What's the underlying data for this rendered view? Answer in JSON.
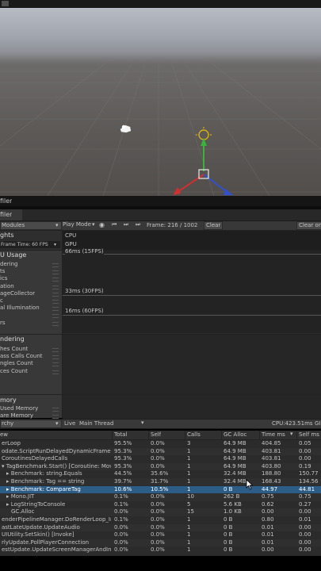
{
  "toolbar_top": {
    "bg": "#1a1a1a"
  },
  "scene": {
    "gizmo_colors": {
      "x": "#d03030",
      "y": "#3ab33a",
      "z": "#3050d0",
      "light": "#f2c200"
    }
  },
  "profiler_tab_bar": {
    "label": "filer"
  },
  "profiler_window_tab": {
    "label": "filer"
  },
  "toolbar": {
    "modules_label": "Modules",
    "play_mode_label": "Play Mode",
    "frame_label": "Frame: 216 / 1002",
    "clear_label": "Clear",
    "clear_on_label": "Clear on"
  },
  "modules": {
    "highlights_title": "ghts",
    "frame_time_label": "Frame Time: 60 FPS",
    "cpu_header": "U Usage",
    "cpu_items": [
      "dering",
      "ts",
      "ics",
      "ation",
      "ageCollector",
      "c",
      "al Illumination",
      "",
      "rs"
    ],
    "rendering_header": "ndering",
    "rendering_items": [
      "hes Count",
      "ass Calls Count",
      "ngles Count",
      "ces Count"
    ],
    "memory_header": "mory",
    "memory_items": [
      "Used Memory",
      "are Memory"
    ]
  },
  "chart": {
    "cpu_label": "CPU",
    "gpu_label": "GPU",
    "markers": [
      "66ms (15FPS)",
      "33ms (30FPS)",
      "16ms (60FPS)"
    ]
  },
  "details_bar": {
    "view_label": "rchy",
    "live_label": "Live",
    "thread_label": "Main Thread",
    "cpu_time": "CPU:423.51ms",
    "gpu_label": "GI"
  },
  "table": {
    "headers": {
      "name": "ew",
      "total": "Total",
      "self": "Self",
      "calls": "Calls",
      "gc": "GC Alloc",
      "time": "Time ms",
      "self_ms": "Self ms"
    },
    "rows": [
      {
        "name": "erLoop",
        "total": "95.5%",
        "self": "0.0%",
        "calls": "3",
        "gc": "64.9 MB",
        "time": "404.85",
        "self_ms": "0.05"
      },
      {
        "name": "odate.ScriptRunDelayedDynamicFrameRate",
        "total": "95.3%",
        "self": "0.0%",
        "calls": "1",
        "gc": "64.9 MB",
        "time": "403.81",
        "self_ms": "0.00"
      },
      {
        "name": "CoroutinesDelayedCalls",
        "total": "95.3%",
        "self": "0.0%",
        "calls": "1",
        "gc": "64.9 MB",
        "time": "403.81",
        "self_ms": "0.00"
      },
      {
        "name": "▾ TagBenchmark.Start() [Coroutine: Move",
        "total": "95.3%",
        "self": "0.0%",
        "calls": "1",
        "gc": "64.9 MB",
        "time": "403.80",
        "self_ms": "0.19"
      },
      {
        "name": "▸ Benchmark: string.Equals",
        "total": "44.5%",
        "self": "35.6%",
        "calls": "1",
        "gc": "32.4 MB",
        "time": "188.80",
        "self_ms": "150.77"
      },
      {
        "name": "▸ Benchmark: Tag == string",
        "total": "39.7%",
        "self": "31.7%",
        "calls": "1",
        "gc": "32.4 MB",
        "time": "168.43",
        "self_ms": "134.56"
      },
      {
        "name": "▸ Benchmark: CompareTag",
        "total": "10.6%",
        "self": "10.5%",
        "calls": "1",
        "gc": "0 B",
        "time": "44.97",
        "self_ms": "44.81"
      },
      {
        "name": "▸ Mono.JIT",
        "total": "0.1%",
        "self": "0.0%",
        "calls": "10",
        "gc": "262 B",
        "time": "0.75",
        "self_ms": "0.75"
      },
      {
        "name": "▸ LogStringToConsole",
        "total": "0.1%",
        "self": "0.0%",
        "calls": "5",
        "gc": "5.6 KB",
        "time": "0.62",
        "self_ms": "0.27"
      },
      {
        "name": "GC.Alloc",
        "total": "0.0%",
        "self": "0.0%",
        "calls": "15",
        "gc": "1.0 KB",
        "time": "0.00",
        "self_ms": "0.00"
      },
      {
        "name": "enderPipelineManager.DoRenderLoop_Inter",
        "total": "0.1%",
        "self": "0.0%",
        "calls": "1",
        "gc": "0 B",
        "time": "0.80",
        "self_ms": "0.01"
      },
      {
        "name": "astLateUpdate.UpdateAudio",
        "total": "0.0%",
        "self": "0.0%",
        "calls": "1",
        "gc": "0 B",
        "time": "0.01",
        "self_ms": "0.00"
      },
      {
        "name": "UIUtility.SetSkin() [Invoke]",
        "total": "0.0%",
        "self": "0.0%",
        "calls": "1",
        "gc": "0 B",
        "time": "0.01",
        "self_ms": "0.00"
      },
      {
        "name": "rlyUpdate.PollPlayerConnection",
        "total": "0.0%",
        "self": "0.0%",
        "calls": "1",
        "gc": "0 B",
        "time": "0.01",
        "self_ms": "0.00"
      },
      {
        "name": "estUpdate.UpdateScreenManagerAndInput",
        "total": "0.0%",
        "self": "0.0%",
        "calls": "1",
        "gc": "0 B",
        "time": "0.00",
        "self_ms": "0.00"
      }
    ],
    "selected_index": 6
  }
}
